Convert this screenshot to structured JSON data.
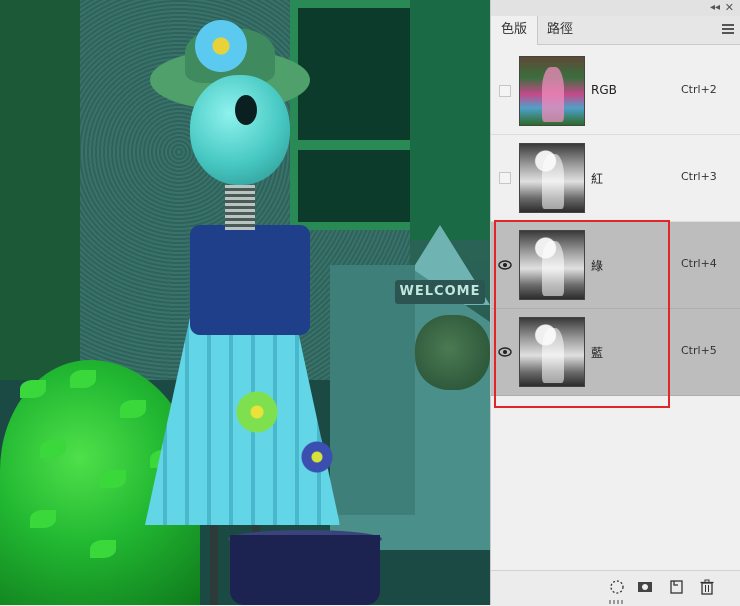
{
  "panel": {
    "tabs": [
      {
        "label": "色版",
        "active": true
      },
      {
        "label": "路徑",
        "active": false
      }
    ],
    "channels": [
      {
        "name": "RGB",
        "shortcut": "Ctrl+2",
        "visible": false,
        "selected": false,
        "thumb": "color"
      },
      {
        "name": "紅",
        "shortcut": "Ctrl+3",
        "visible": false,
        "selected": false,
        "thumb": "gray"
      },
      {
        "name": "綠",
        "shortcut": "Ctrl+4",
        "visible": true,
        "selected": true,
        "thumb": "gray"
      },
      {
        "name": "藍",
        "shortcut": "Ctrl+5",
        "visible": true,
        "selected": true,
        "thumb": "gray"
      }
    ],
    "bottom_icons": [
      "load-selection-icon",
      "save-selection-icon",
      "new-channel-icon",
      "delete-channel-icon"
    ],
    "top_icons": [
      "collapse-icon",
      "close-icon",
      "panel-menu-icon"
    ]
  },
  "photo": {
    "sign_text": "WELCOME"
  },
  "colors": {
    "highlight": "#e0262a",
    "selected_row": "#bdbdbd"
  }
}
